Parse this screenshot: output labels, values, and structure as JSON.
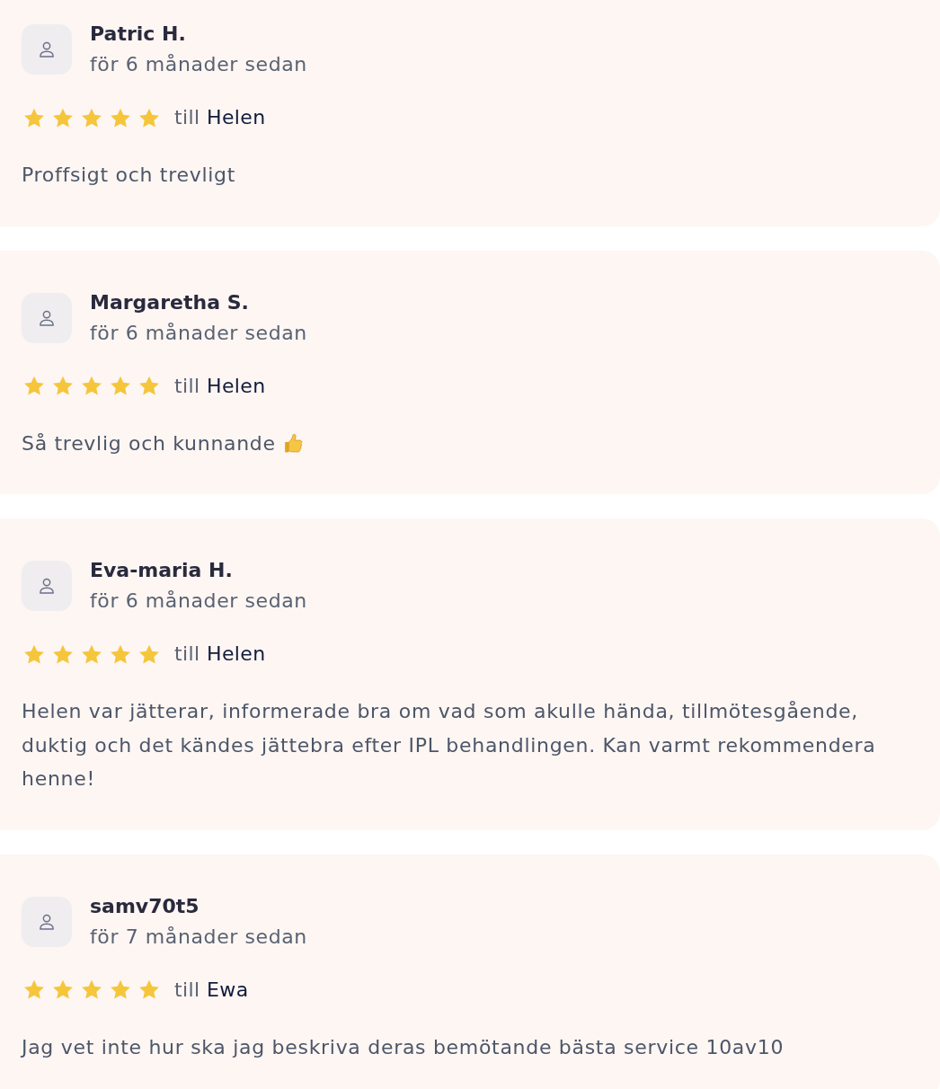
{
  "reviews": [
    {
      "author": "Patric H.",
      "posted": "för 6 månader sedan",
      "stars": 5,
      "to_label": "till",
      "staff": "Helen",
      "text": "Proffsigt och trevligt",
      "emoji": false
    },
    {
      "author": "Margaretha S.",
      "posted": "för 6 månader sedan",
      "stars": 5,
      "to_label": "till",
      "staff": "Helen",
      "text": "Så trevlig och kunnande",
      "emoji": true
    },
    {
      "author": "Eva-maria H.",
      "posted": "för 6 månader sedan",
      "stars": 5,
      "to_label": "till",
      "staff": "Helen",
      "text": "Helen var jätterar, informerade bra om vad som akulle hända, tillmötesgående, duktig och det kändes jättebra efter IPL behandlingen. Kan varmt rekommendera henne!",
      "emoji": false
    },
    {
      "author": "samv70t5",
      "posted": "för 7 månader sedan",
      "stars": 5,
      "to_label": "till",
      "staff": "Ewa",
      "text": "Jag vet inte hur ska jag beskriva deras bemötande bästa service 10av10",
      "emoji": false
    }
  ]
}
